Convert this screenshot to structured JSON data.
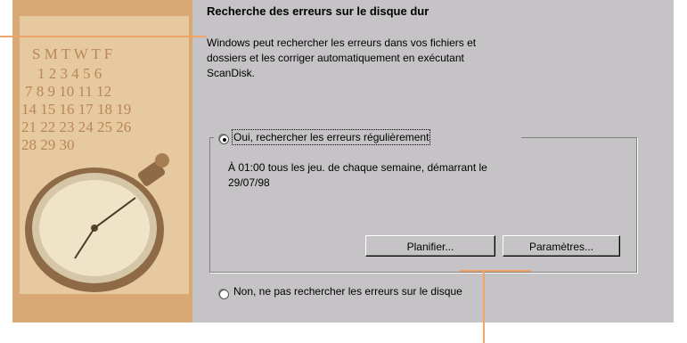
{
  "heading": "Recherche des erreurs sur le disque dur",
  "intro_lines": [
    "Windows peut rechercher les erreurs dans vos fichiers et",
    "dossiers et les corriger automatiquement en exécutant",
    "ScanDisk."
  ],
  "option_yes": "Oui, rechercher les erreurs régulièrement",
  "schedule_lines": [
    "À 01:00 tous les jeu. de chaque semaine, démarrant le",
    "29/07/98"
  ],
  "buttons": {
    "schedule": "Planifier...",
    "settings": "Paramètres..."
  },
  "option_no": "Non, ne pas rechercher les erreurs sur le disque",
  "selected_option": "yes",
  "colors": {
    "dialog_background": "#c6c3c6",
    "illustration_background": "#d8a974",
    "callout_line": "#f0a468"
  }
}
